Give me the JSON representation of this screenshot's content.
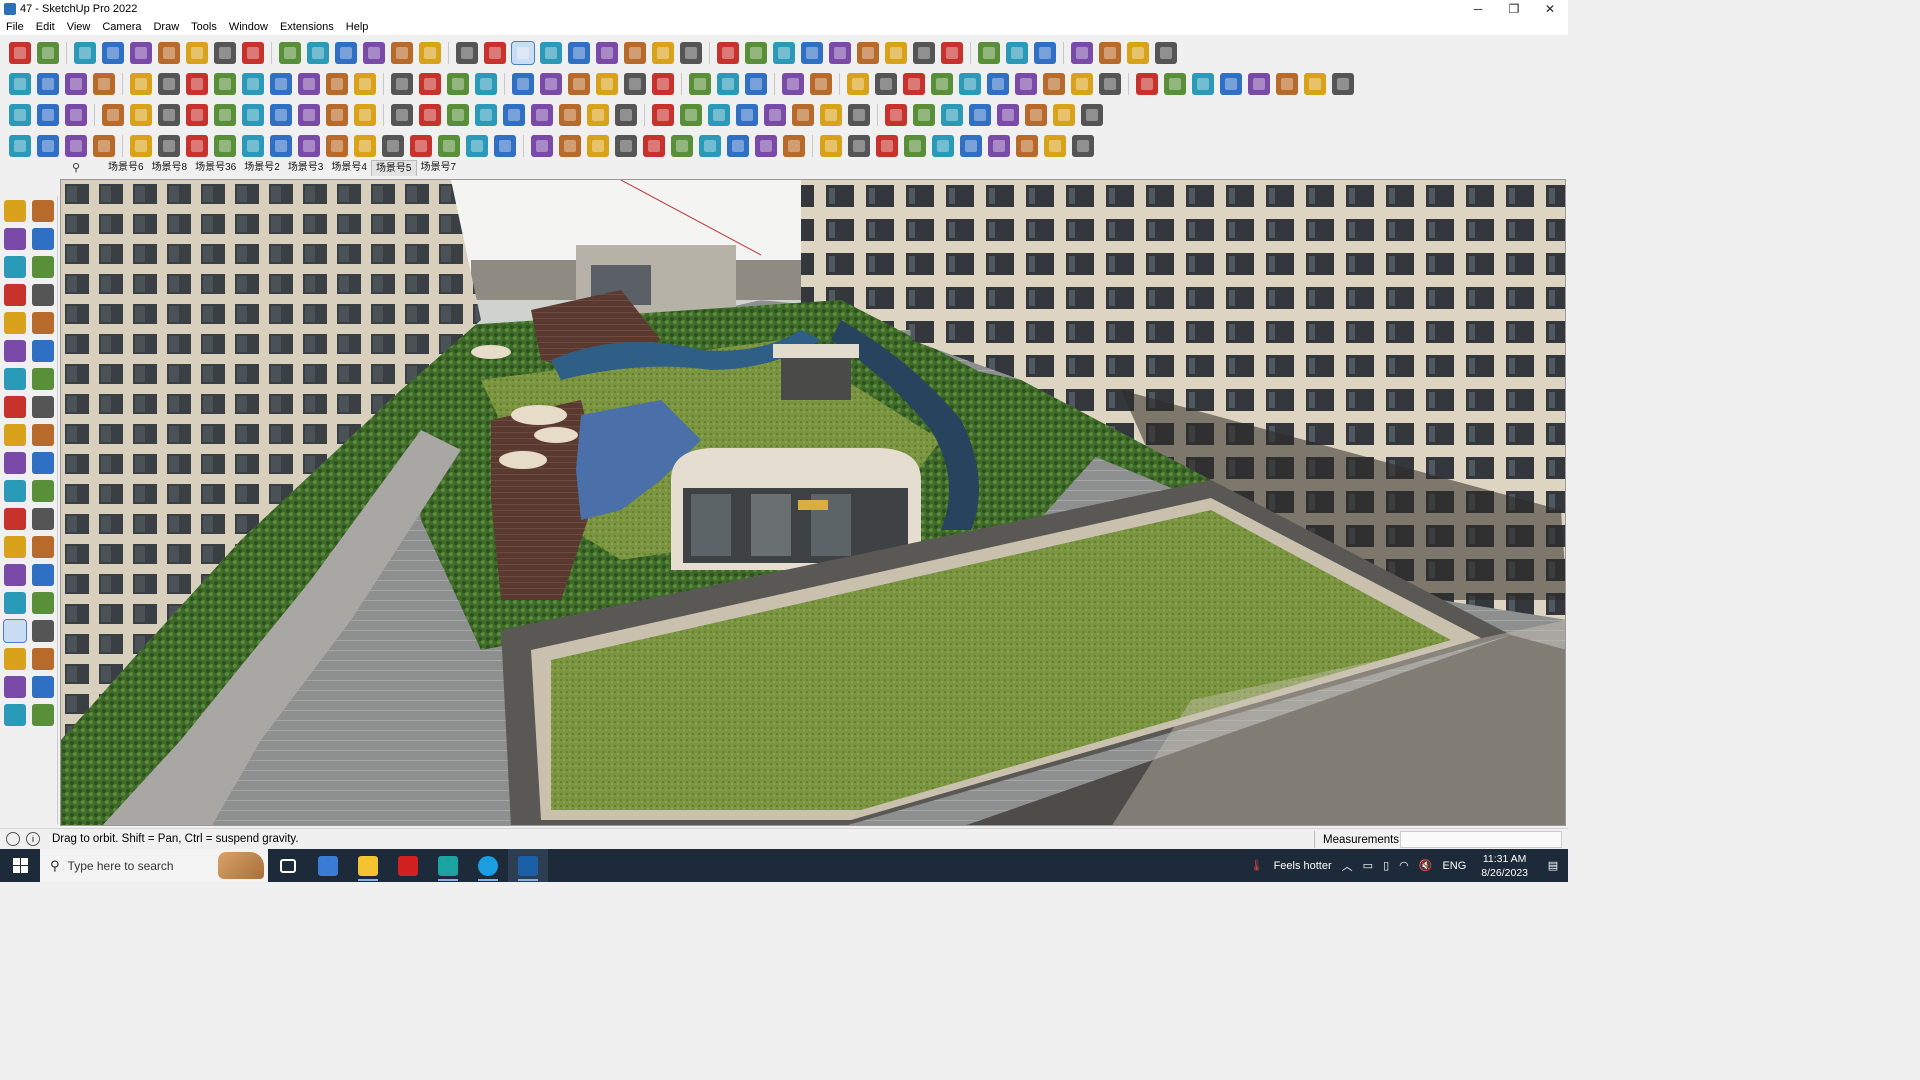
{
  "window": {
    "title": "47 - SketchUp Pro 2022",
    "minimize": "─",
    "maximize": "❐",
    "close": "✕"
  },
  "menu": {
    "items": [
      "File",
      "Edit",
      "View",
      "Camera",
      "Draw",
      "Tools",
      "Window",
      "Extensions",
      "Help"
    ]
  },
  "scenes": {
    "search_icon": "⚲",
    "tabs": [
      "场景号6",
      "场景号8",
      "场景号36",
      "场景号2",
      "场景号3",
      "场景号4",
      "场景号5",
      "场景号7"
    ],
    "active_index": 6
  },
  "status": {
    "info_icon": "i",
    "hint": "Drag to orbit. Shift = Pan, Ctrl = suspend gravity.",
    "measurements_label": "Measurements",
    "measurements_value": ""
  },
  "taskbar": {
    "search_placeholder": "Type here to search",
    "weather": "Feels hotter",
    "language": "ENG",
    "time": "11:31 AM",
    "date": "8/26/2023",
    "apps": [
      {
        "name": "task-view",
        "color": "#ffffff"
      },
      {
        "name": "calculator",
        "color": "#3a7bd5"
      },
      {
        "name": "file-explorer",
        "color": "#f4c430"
      },
      {
        "name": "acrobat",
        "color": "#d32020"
      },
      {
        "name": "3dsmax",
        "color": "#1aa3a3"
      },
      {
        "name": "edge",
        "color": "#1b9de2"
      },
      {
        "name": "sketchup",
        "color": "#1b5fa6"
      }
    ]
  },
  "colors": {
    "toolbar_red": "#c8322d",
    "toolbar_blue": "#2f6fc4",
    "toolbar_yellow": "#d9a21b",
    "lawn": "#6e8f3a",
    "building": "#d8d0c0"
  }
}
